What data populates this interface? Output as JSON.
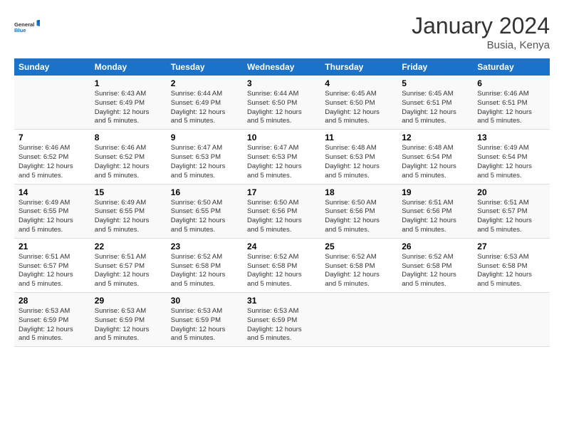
{
  "header": {
    "logo_line1": "General",
    "logo_line2": "Blue",
    "month_title": "January 2024",
    "location": "Busia, Kenya"
  },
  "days_of_week": [
    "Sunday",
    "Monday",
    "Tuesday",
    "Wednesday",
    "Thursday",
    "Friday",
    "Saturday"
  ],
  "weeks": [
    [
      {
        "day": "",
        "info": ""
      },
      {
        "day": "1",
        "info": "Sunrise: 6:43 AM\nSunset: 6:49 PM\nDaylight: 12 hours\nand 5 minutes."
      },
      {
        "day": "2",
        "info": "Sunrise: 6:44 AM\nSunset: 6:49 PM\nDaylight: 12 hours\nand 5 minutes."
      },
      {
        "day": "3",
        "info": "Sunrise: 6:44 AM\nSunset: 6:50 PM\nDaylight: 12 hours\nand 5 minutes."
      },
      {
        "day": "4",
        "info": "Sunrise: 6:45 AM\nSunset: 6:50 PM\nDaylight: 12 hours\nand 5 minutes."
      },
      {
        "day": "5",
        "info": "Sunrise: 6:45 AM\nSunset: 6:51 PM\nDaylight: 12 hours\nand 5 minutes."
      },
      {
        "day": "6",
        "info": "Sunrise: 6:46 AM\nSunset: 6:51 PM\nDaylight: 12 hours\nand 5 minutes."
      }
    ],
    [
      {
        "day": "7",
        "info": "Sunrise: 6:46 AM\nSunset: 6:52 PM\nDaylight: 12 hours\nand 5 minutes."
      },
      {
        "day": "8",
        "info": "Sunrise: 6:46 AM\nSunset: 6:52 PM\nDaylight: 12 hours\nand 5 minutes."
      },
      {
        "day": "9",
        "info": "Sunrise: 6:47 AM\nSunset: 6:53 PM\nDaylight: 12 hours\nand 5 minutes."
      },
      {
        "day": "10",
        "info": "Sunrise: 6:47 AM\nSunset: 6:53 PM\nDaylight: 12 hours\nand 5 minutes."
      },
      {
        "day": "11",
        "info": "Sunrise: 6:48 AM\nSunset: 6:53 PM\nDaylight: 12 hours\nand 5 minutes."
      },
      {
        "day": "12",
        "info": "Sunrise: 6:48 AM\nSunset: 6:54 PM\nDaylight: 12 hours\nand 5 minutes."
      },
      {
        "day": "13",
        "info": "Sunrise: 6:49 AM\nSunset: 6:54 PM\nDaylight: 12 hours\nand 5 minutes."
      }
    ],
    [
      {
        "day": "14",
        "info": "Sunrise: 6:49 AM\nSunset: 6:55 PM\nDaylight: 12 hours\nand 5 minutes."
      },
      {
        "day": "15",
        "info": "Sunrise: 6:49 AM\nSunset: 6:55 PM\nDaylight: 12 hours\nand 5 minutes."
      },
      {
        "day": "16",
        "info": "Sunrise: 6:50 AM\nSunset: 6:55 PM\nDaylight: 12 hours\nand 5 minutes."
      },
      {
        "day": "17",
        "info": "Sunrise: 6:50 AM\nSunset: 6:56 PM\nDaylight: 12 hours\nand 5 minutes."
      },
      {
        "day": "18",
        "info": "Sunrise: 6:50 AM\nSunset: 6:56 PM\nDaylight: 12 hours\nand 5 minutes."
      },
      {
        "day": "19",
        "info": "Sunrise: 6:51 AM\nSunset: 6:56 PM\nDaylight: 12 hours\nand 5 minutes."
      },
      {
        "day": "20",
        "info": "Sunrise: 6:51 AM\nSunset: 6:57 PM\nDaylight: 12 hours\nand 5 minutes."
      }
    ],
    [
      {
        "day": "21",
        "info": "Sunrise: 6:51 AM\nSunset: 6:57 PM\nDaylight: 12 hours\nand 5 minutes."
      },
      {
        "day": "22",
        "info": "Sunrise: 6:51 AM\nSunset: 6:57 PM\nDaylight: 12 hours\nand 5 minutes."
      },
      {
        "day": "23",
        "info": "Sunrise: 6:52 AM\nSunset: 6:58 PM\nDaylight: 12 hours\nand 5 minutes."
      },
      {
        "day": "24",
        "info": "Sunrise: 6:52 AM\nSunset: 6:58 PM\nDaylight: 12 hours\nand 5 minutes."
      },
      {
        "day": "25",
        "info": "Sunrise: 6:52 AM\nSunset: 6:58 PM\nDaylight: 12 hours\nand 5 minutes."
      },
      {
        "day": "26",
        "info": "Sunrise: 6:52 AM\nSunset: 6:58 PM\nDaylight: 12 hours\nand 5 minutes."
      },
      {
        "day": "27",
        "info": "Sunrise: 6:53 AM\nSunset: 6:58 PM\nDaylight: 12 hours\nand 5 minutes."
      }
    ],
    [
      {
        "day": "28",
        "info": "Sunrise: 6:53 AM\nSunset: 6:59 PM\nDaylight: 12 hours\nand 5 minutes."
      },
      {
        "day": "29",
        "info": "Sunrise: 6:53 AM\nSunset: 6:59 PM\nDaylight: 12 hours\nand 5 minutes."
      },
      {
        "day": "30",
        "info": "Sunrise: 6:53 AM\nSunset: 6:59 PM\nDaylight: 12 hours\nand 5 minutes."
      },
      {
        "day": "31",
        "info": "Sunrise: 6:53 AM\nSunset: 6:59 PM\nDaylight: 12 hours\nand 5 minutes."
      },
      {
        "day": "",
        "info": ""
      },
      {
        "day": "",
        "info": ""
      },
      {
        "day": "",
        "info": ""
      }
    ]
  ]
}
